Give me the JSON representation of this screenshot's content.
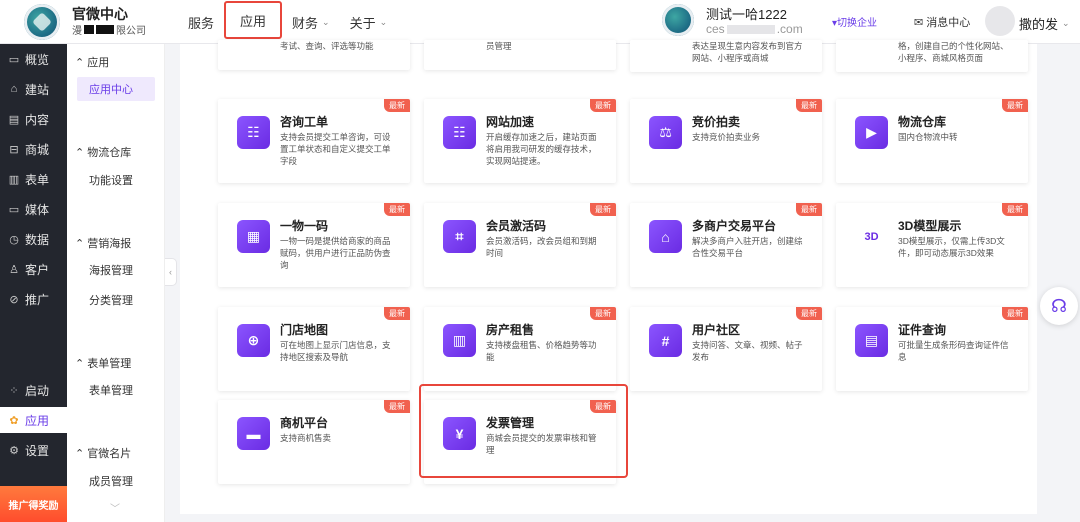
{
  "header": {
    "brand_title": "官微中心",
    "brand_sub_prefix": "漫",
    "brand_sub_suffix": "限公司",
    "nav": [
      {
        "label": "服务",
        "caret": ""
      },
      {
        "label": "应用",
        "caret": ""
      },
      {
        "label": "财务",
        "caret": "⌄"
      },
      {
        "label": "关于",
        "caret": "⌄"
      }
    ],
    "account_name": "测试一哈1222",
    "account_domain_prefix": "ces",
    "account_domain_suffix": ".com",
    "switch_label": "▾切换企业",
    "message_label": "消息中心",
    "user_name": "撒的发",
    "user_caret": "⌄"
  },
  "dark_sidebar": [
    {
      "label": "概览",
      "icon": "▭"
    },
    {
      "label": "建站",
      "icon": "⌂"
    },
    {
      "label": "内容",
      "icon": "▤"
    },
    {
      "label": "商城",
      "icon": "⊟"
    },
    {
      "label": "表单",
      "icon": "▥"
    },
    {
      "label": "媒体",
      "icon": "▭"
    },
    {
      "label": "数据",
      "icon": "◷"
    },
    {
      "label": "客户",
      "icon": "♙"
    },
    {
      "label": "推广",
      "icon": "⊘"
    },
    {
      "label": "启动",
      "icon": "⁘"
    },
    {
      "label": "应用",
      "icon": "✿"
    },
    {
      "label": "设置",
      "icon": "⚙"
    }
  ],
  "promo_label": "推广得奖励",
  "sub_sidebar": {
    "groups": [
      {
        "title": "应用",
        "items": [
          "应用中心"
        ]
      },
      {
        "title": "物流仓库",
        "items": [
          "功能设置"
        ]
      },
      {
        "title": "营销海报",
        "items": [
          "海报管理",
          "分类管理"
        ]
      },
      {
        "title": "表单管理",
        "items": [
          "表单管理"
        ]
      },
      {
        "title": "官微名片",
        "items": [
          "成员管理"
        ]
      }
    ]
  },
  "partial_cards": [
    {
      "desc": "考试、查询、评选等功能"
    },
    {
      "desc": "员管理"
    },
    {
      "desc": "表达呈现生意内容发布到官方网站、小程序或商城"
    },
    {
      "desc": "格，创建自己的个性化网站、小程序、商城风格页面"
    }
  ],
  "badge_label": "最新",
  "cards": [
    {
      "title": "咨询工单",
      "desc": "支持会员提交工单咨询，可设置工单状态和自定义提交工单字段",
      "icon": "☷"
    },
    {
      "title": "网站加速",
      "desc": "开启缓存加速之后，建站页面将启用我司研发的缓存技术，实现网站提速。",
      "icon": "☷"
    },
    {
      "title": "竞价拍卖",
      "desc": "支持竞价拍卖业务",
      "icon": "⚖"
    },
    {
      "title": "物流仓库",
      "desc": "国内仓物流中转",
      "icon": "▶"
    },
    {
      "title": "一物一码",
      "desc": "一物一码是提供给商家的商品赋码，供用户进行正品防伪查询",
      "icon": "▦"
    },
    {
      "title": "会员激活码",
      "desc": "会员激活码，改会员组和到期时间",
      "icon": "⌗"
    },
    {
      "title": "多商户交易平台",
      "desc": "解决多商户入驻开店，创建综合性交易平台",
      "icon": "⌂"
    },
    {
      "title": "3D模型展示",
      "desc": "3D模型展示，仅需上传3D文件，即可动态展示3D效果",
      "icon": "3D"
    },
    {
      "title": "门店地图",
      "desc": "可在地图上显示门店信息，支持地区搜索及导航",
      "icon": "⊕"
    },
    {
      "title": "房产租售",
      "desc": "支持楼盘租售、价格趋势等功能",
      "icon": "▥"
    },
    {
      "title": "用户社区",
      "desc": "支持问答、文章、视频、帖子发布",
      "icon": "#"
    },
    {
      "title": "证件查询",
      "desc": "可批量生成条形码查询证件信息",
      "icon": "▤"
    },
    {
      "title": "商机平台",
      "desc": "支持商机售卖",
      "icon": "▬"
    },
    {
      "title": "发票管理",
      "desc": "商城会员提交的发票审核和管理",
      "icon": "¥"
    }
  ]
}
